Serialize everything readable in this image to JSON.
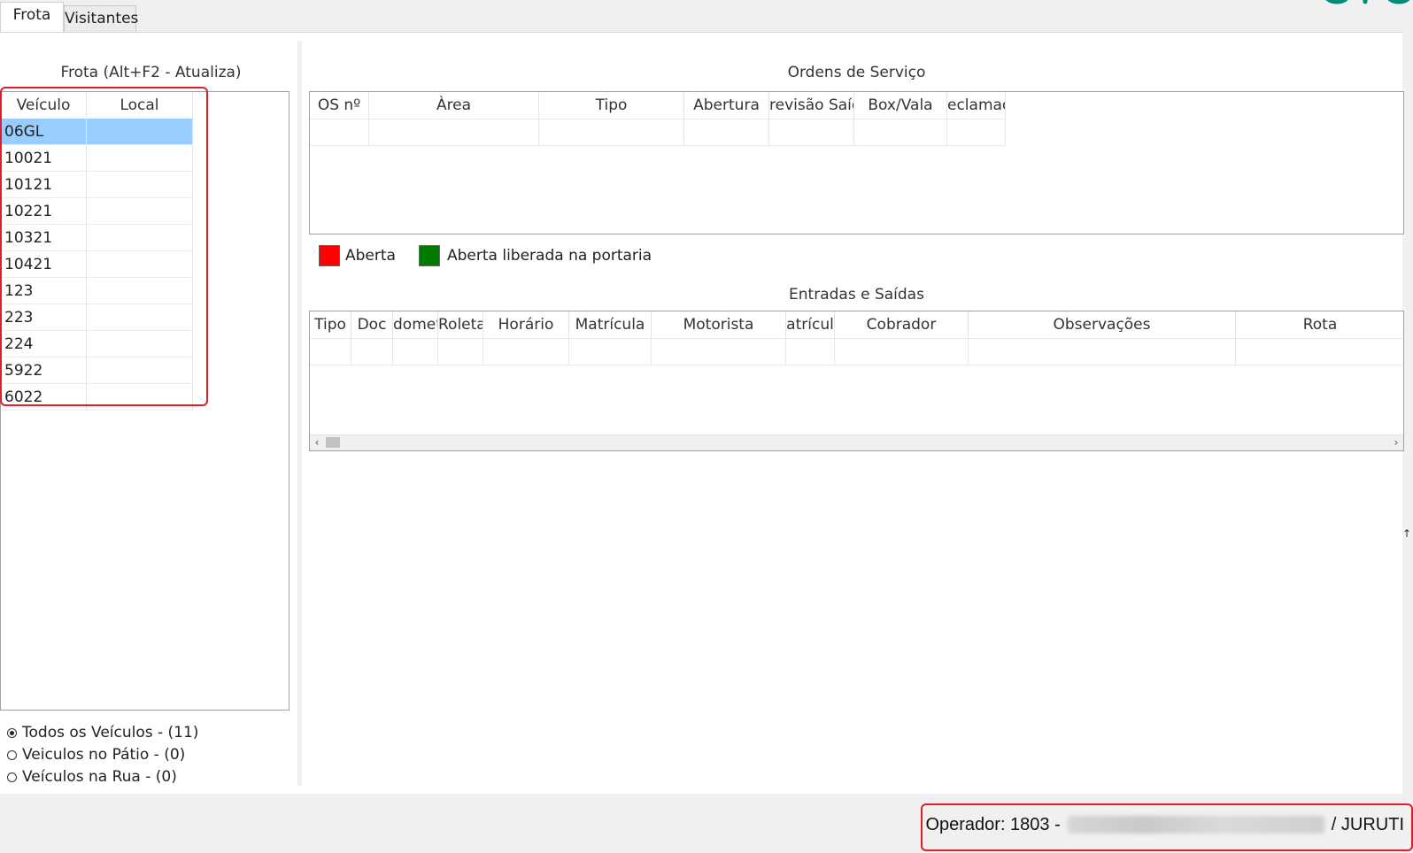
{
  "tabs": [
    {
      "label": "Frota",
      "active": true
    },
    {
      "label": "Visitantes",
      "active": false
    }
  ],
  "fleet": {
    "title": "Frota   (Alt+F2 - Atualiza)",
    "columns": [
      "Veículo",
      "Local"
    ],
    "rows": [
      {
        "vehicle": "06GL",
        "local": "",
        "selected": true
      },
      {
        "vehicle": "10021",
        "local": ""
      },
      {
        "vehicle": "10121",
        "local": ""
      },
      {
        "vehicle": "10221",
        "local": ""
      },
      {
        "vehicle": "10321",
        "local": ""
      },
      {
        "vehicle": "10421",
        "local": ""
      },
      {
        "vehicle": "123",
        "local": ""
      },
      {
        "vehicle": "223",
        "local": ""
      },
      {
        "vehicle": "224",
        "local": ""
      },
      {
        "vehicle": "5922",
        "local": ""
      },
      {
        "vehicle": "6022",
        "local": ""
      }
    ]
  },
  "filters": [
    {
      "label": "Todos os Veículos - (11)",
      "checked": true
    },
    {
      "label": "Veiculos no Pátio - (0)",
      "checked": false
    },
    {
      "label": "Veículos na Rua - (0)",
      "checked": false
    }
  ],
  "orders": {
    "title": "Ordens de Serviço",
    "columns": [
      "OS nº",
      "Àrea",
      "Tipo",
      "Abertura",
      "revisão Saíd",
      "Box/Vala",
      "eclamaç"
    ]
  },
  "legend": [
    {
      "label": "Aberta",
      "color": "#ff0000"
    },
    {
      "label": "Aberta liberada na portaria",
      "color": "#007a00"
    }
  ],
  "entries": {
    "title": "Entradas e Saídas",
    "columns": [
      "Tipo",
      "Doc",
      "dometr",
      "Roleta",
      "Horário",
      "Matrícula",
      "Motorista",
      "atrícul",
      "Cobrador",
      "Observações",
      "Rota"
    ]
  },
  "status": {
    "prefix": "Operador: 1803 -",
    "suffix": "/ JURUTI"
  },
  "colors": {
    "selection": "#99ccff",
    "highlight_border": "#e01d2b",
    "brand": "#008a7a"
  }
}
